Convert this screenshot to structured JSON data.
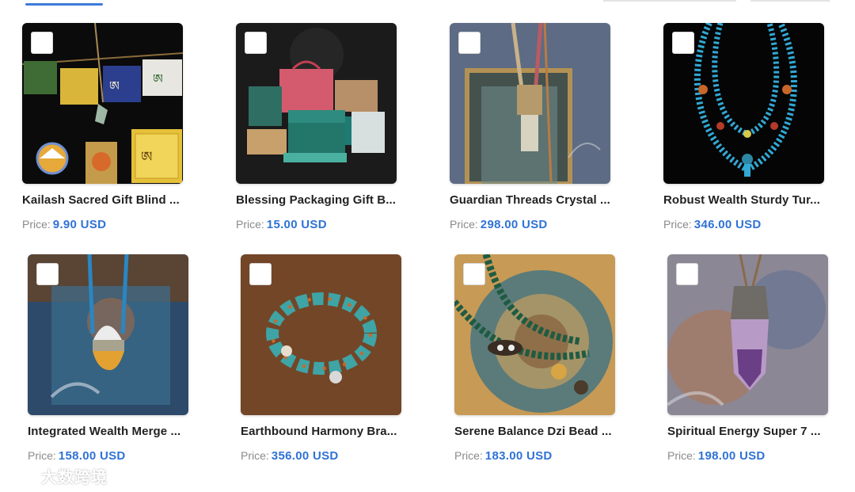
{
  "price_label": "Price:",
  "watermark_text": "大数跨境",
  "products": [
    {
      "title": "Kailash Sacred Gift Blind ...",
      "price": "9.90 USD"
    },
    {
      "title": "Blessing Packaging Gift B...",
      "price": "15.00 USD"
    },
    {
      "title": "Guardian Threads Crystal ...",
      "price": "298.00 USD"
    },
    {
      "title": "Robust Wealth Sturdy Tur...",
      "price": "346.00 USD"
    },
    {
      "title": "Integrated Wealth Merge ...",
      "price": "158.00 USD"
    },
    {
      "title": "Earthbound Harmony Bra...",
      "price": "356.00 USD"
    },
    {
      "title": "Serene Balance Dzi Bead ...",
      "price": "183.00 USD"
    },
    {
      "title": "Spiritual Energy Super 7 ...",
      "price": "198.00 USD"
    }
  ],
  "colors": {
    "price_accent": "#2f72d6",
    "tab_indicator": "#3f7ad9"
  }
}
